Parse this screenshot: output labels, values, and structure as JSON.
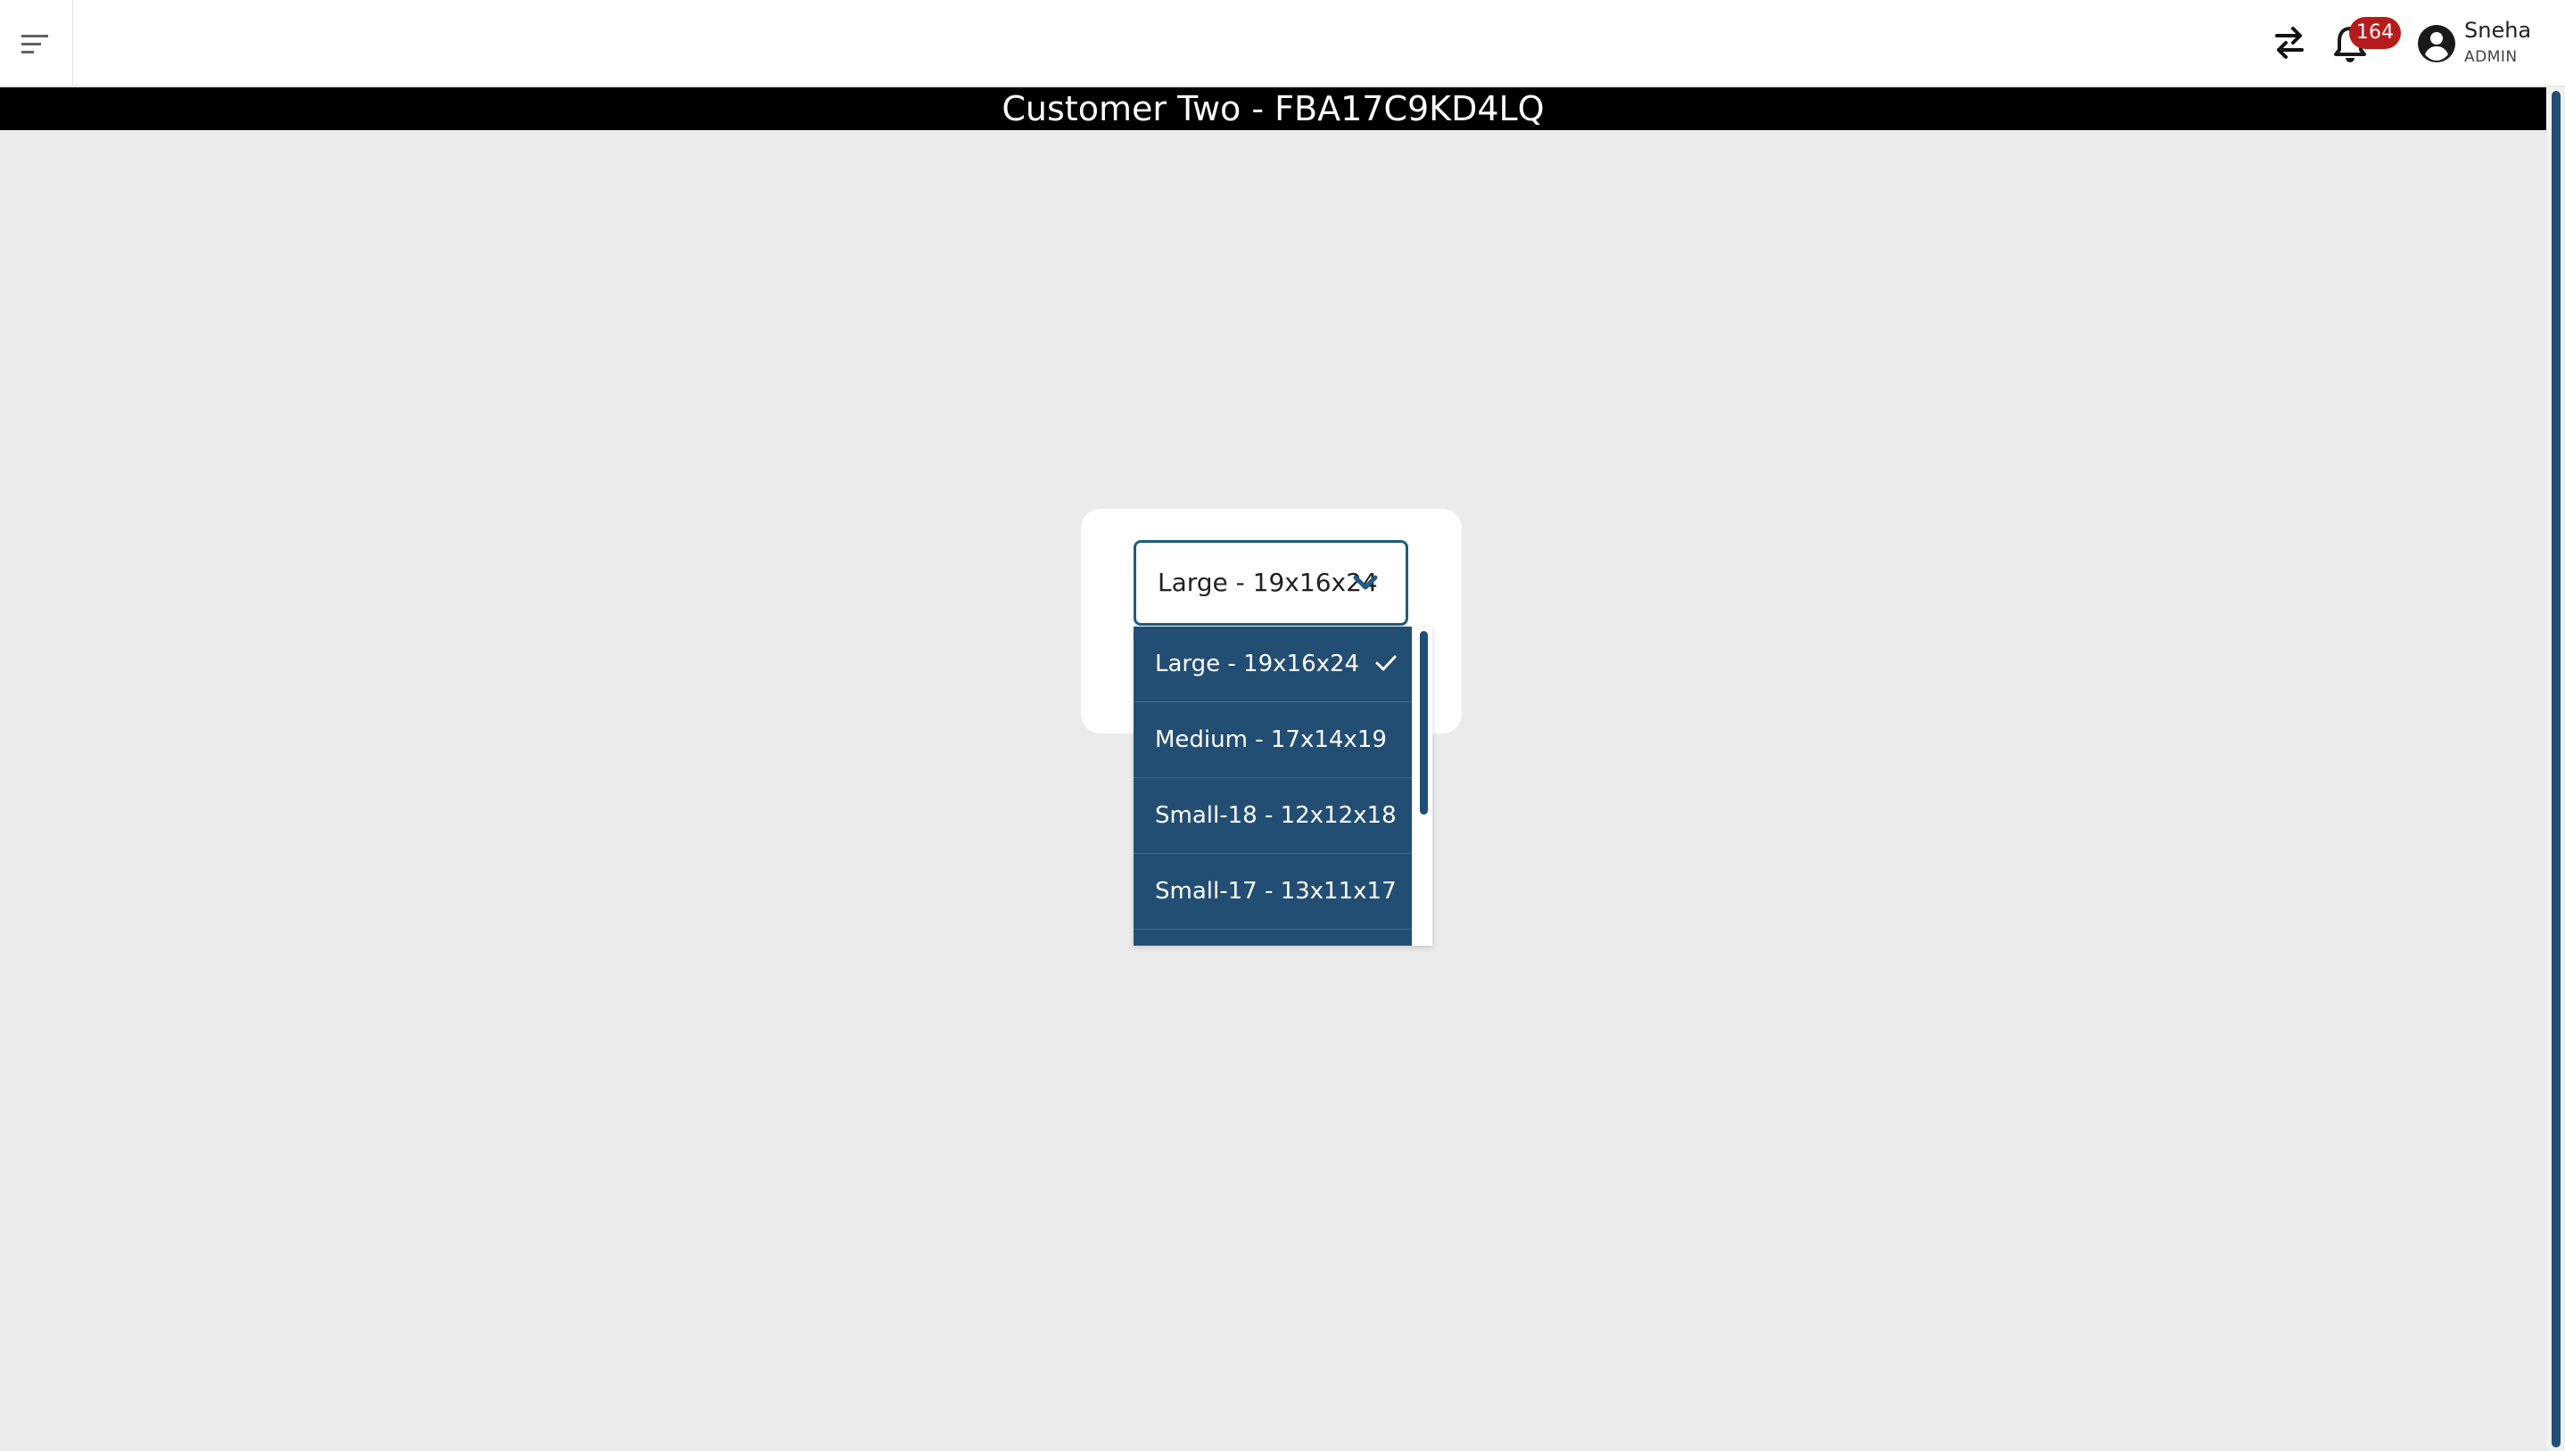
{
  "header": {
    "notification_count": "164",
    "user": {
      "name": "Sneha",
      "role": "ADMIN"
    },
    "icons": {
      "menu": "menu-icon",
      "swap": "swap-arrows-icon",
      "notifications": "bell-icon",
      "avatar": "account-circle-icon"
    }
  },
  "title_bar": {
    "title": "Customer Two - FBA17C9KD4LQ"
  },
  "box_select": {
    "selected_value": "Large - 19x16x24",
    "options": [
      {
        "label": "Large - 19x16x24",
        "selected": true
      },
      {
        "label": "Medium - 17x14x19",
        "selected": false
      },
      {
        "label": "Small-18 - 12x12x18",
        "selected": false
      },
      {
        "label": "Small-17 - 13x11x17",
        "selected": false
      }
    ]
  },
  "colors": {
    "accent": "#234e73",
    "badge": "#b71c1c",
    "title_bar": "#000000",
    "background": "#ebebeb"
  }
}
